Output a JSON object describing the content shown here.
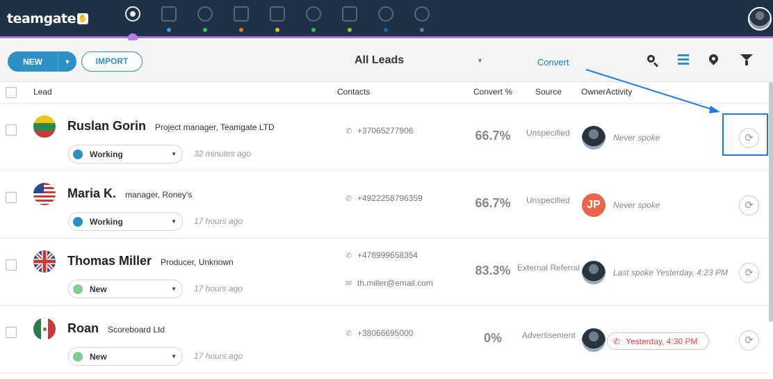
{
  "app": {
    "logo": "teamgate"
  },
  "nav": {
    "items": [
      {
        "icon": "target-icon",
        "dot_color": ""
      },
      {
        "icon": "building-icon",
        "dot_color": "#3a9be0"
      },
      {
        "icon": "contacts-icon",
        "dot_color": "#3dbb55"
      },
      {
        "icon": "deals-icon",
        "dot_color": "#e07a3a"
      },
      {
        "icon": "calendar-icon",
        "dot_color": "#e0b83a"
      },
      {
        "icon": "chat-icon",
        "dot_color": "#3dbb55"
      },
      {
        "icon": "documents-icon",
        "dot_color": "#8ac43a"
      },
      {
        "icon": "reports-icon",
        "dot_color": "#1a5f9a"
      },
      {
        "icon": "analytics-icon",
        "dot_color": "#5a7a9a"
      }
    ],
    "active_color": "#b77fe6"
  },
  "toolbar": {
    "new_label": "NEW",
    "import_label": "IMPORT",
    "view_label": "All Leads",
    "convert_note": "Convert"
  },
  "table": {
    "headers": {
      "lead": "Lead",
      "contacts": "Contacts",
      "convert": "Convert %",
      "source": "Source",
      "owner_activity": "OwnerActivity"
    },
    "rows": [
      {
        "name": "Ruslan Gorin",
        "title": "Project manager, Teamgate LTD",
        "flag": "lithuania",
        "status": "Working",
        "status_color": "#2e8fc4",
        "time": "32 minutes ago",
        "phone": "+37065277906",
        "email": "",
        "convert": "66.7%",
        "source": "Unspecified",
        "owner": "photo",
        "owner_initials": "",
        "activity": "Never spoke"
      },
      {
        "name": "Maria K.",
        "title": "manager, Roney's",
        "flag": "usa",
        "status": "Working",
        "status_color": "#2e8fc4",
        "time": "17 hours ago",
        "phone": "+4922258796359",
        "email": "",
        "convert": "66.7%",
        "source": "Unspecified",
        "owner": "initials",
        "owner_initials": "JP",
        "activity": "Never spoke"
      },
      {
        "name": "Thomas Miller",
        "title": "Producer, Unknown",
        "flag": "uk",
        "status": "New",
        "status_color": "#7fcf8f",
        "time": "17 hours ago",
        "phone": "+478999658354",
        "email": "th.miller@email.com",
        "convert": "83.3%",
        "source": "External Referral",
        "owner": "photo",
        "owner_initials": "",
        "activity": "Last spoke Yesterday, 4:23 PM"
      },
      {
        "name": "Roan",
        "title": "Scoreboard Ltd",
        "flag": "mexico",
        "status": "New",
        "status_color": "#7fcf8f",
        "time": "17 hours ago",
        "phone": "+38066695000",
        "email": "",
        "convert": "0%",
        "source": "Advertisement",
        "owner": "photo",
        "owner_initials": "",
        "activity": "Yesterday, 4:30 PM"
      }
    ]
  }
}
